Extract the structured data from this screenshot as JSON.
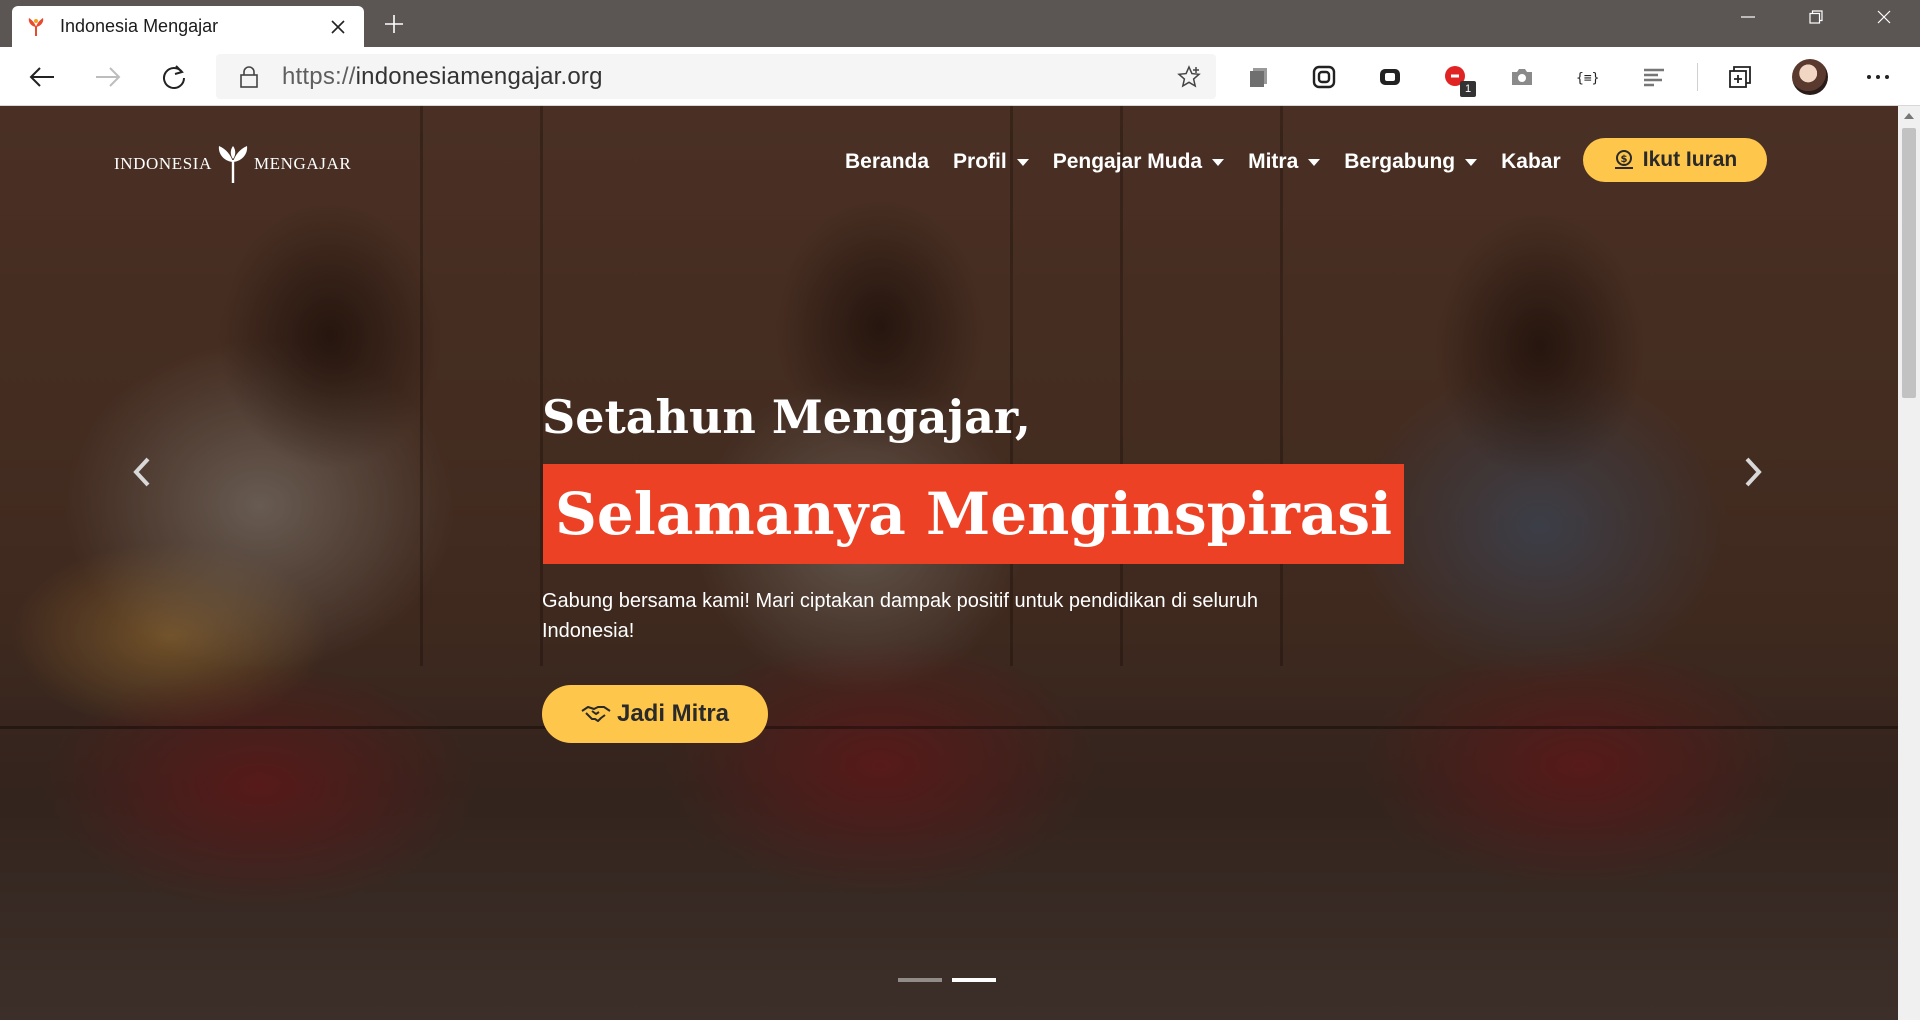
{
  "browser": {
    "tab_title": "Indonesia Mengajar",
    "url_protocol": "https://",
    "url_host": "indonesiamengajar.org",
    "extension_badge": "1"
  },
  "site": {
    "logo_left": "INDONESIA",
    "logo_right": "MENGAJAR",
    "nav": [
      {
        "label": "Beranda",
        "dropdown": false
      },
      {
        "label": "Profil",
        "dropdown": true
      },
      {
        "label": "Pengajar Muda",
        "dropdown": true
      },
      {
        "label": "Mitra",
        "dropdown": true
      },
      {
        "label": "Bergabung",
        "dropdown": true
      },
      {
        "label": "Kabar",
        "dropdown": false
      }
    ],
    "cta_label": "Ikut Iuran"
  },
  "hero": {
    "subtitle": "Setahun Mengajar,",
    "title": "Selamanya Menginspirasi",
    "description": "Gabung bersama kami! Mari ciptakan dampak positif untuk pendidikan di seluruh Indonesia!",
    "button_label": "Jadi Mitra",
    "slide_count": 2,
    "active_slide": 2
  },
  "colors": {
    "accent_yellow": "#fec74b",
    "accent_red": "#ed4126"
  }
}
